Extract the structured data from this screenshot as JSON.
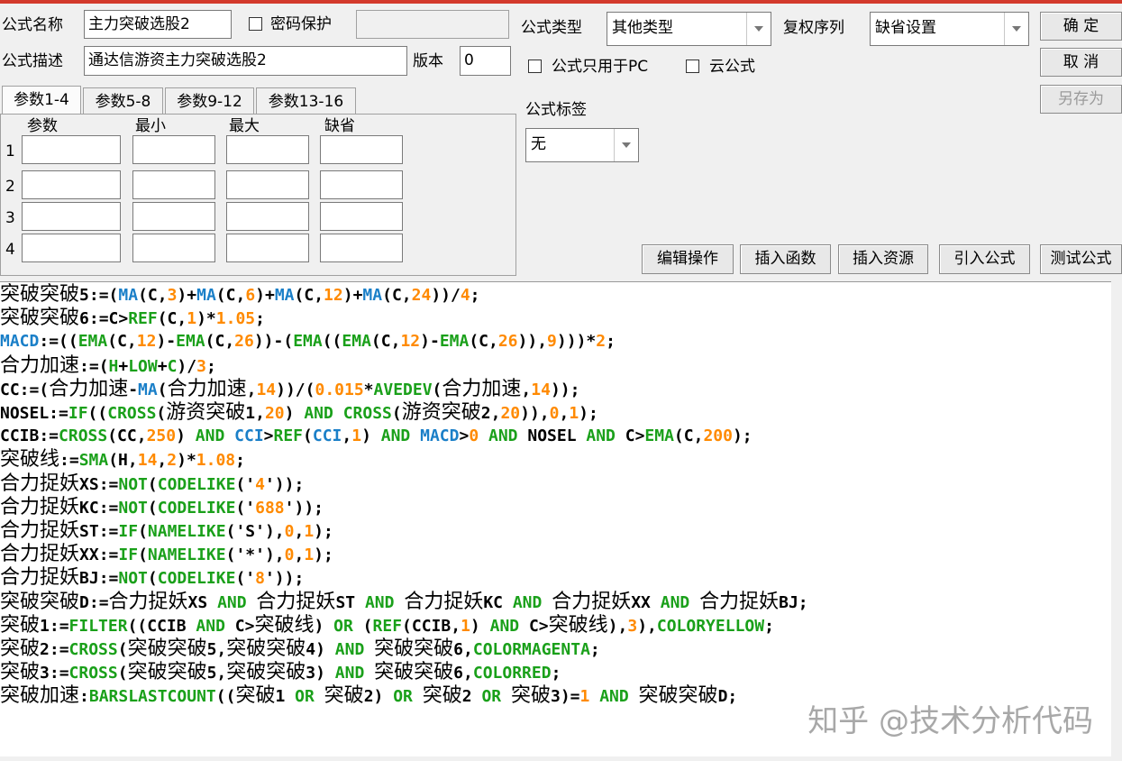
{
  "header": {
    "name_label": "公式名称",
    "name_value": "主力突破选股2",
    "password_label": "密码保护",
    "desc_label": "公式描述",
    "desc_value": "通达信游资主力突破选股2",
    "version_label": "版本",
    "version_value": "0",
    "type_label": "公式类型",
    "type_value": "其他类型",
    "rights_label": "复权序列",
    "rights_value": "缺省设置",
    "pc_only_label": "公式只用于PC",
    "cloud_label": "云公式",
    "tag_label": "公式标签",
    "tag_value": "无"
  },
  "buttons": {
    "ok": "确 定",
    "cancel": "取 消",
    "save_as": "另存为",
    "edit_ops": "编辑操作",
    "insert_func": "插入函数",
    "insert_res": "插入资源",
    "import_formula": "引入公式",
    "test_formula": "测试公式"
  },
  "tabs": [
    "参数1-4",
    "参数5-8",
    "参数9-12",
    "参数13-16"
  ],
  "param_headers": [
    "参数",
    "最小",
    "最大",
    "缺省"
  ],
  "param_rows": [
    "1",
    "2",
    "3",
    "4"
  ],
  "colors": {
    "function": "#1aa01a",
    "builtin": "#1a7fc8",
    "number": "#ff8a00",
    "text": "#000000"
  },
  "code_lines": [
    [
      [
        "zh",
        "突破突破"
      ],
      [
        "t",
        "5:=("
      ],
      [
        "b",
        "MA"
      ],
      [
        "t",
        "(C,"
      ],
      [
        "n",
        "3"
      ],
      [
        "t",
        ")+"
      ],
      [
        "b",
        "MA"
      ],
      [
        "t",
        "(C,"
      ],
      [
        "n",
        "6"
      ],
      [
        "t",
        ")+"
      ],
      [
        "b",
        "MA"
      ],
      [
        "t",
        "(C,"
      ],
      [
        "n",
        "12"
      ],
      [
        "t",
        ")+"
      ],
      [
        "b",
        "MA"
      ],
      [
        "t",
        "(C,"
      ],
      [
        "n",
        "24"
      ],
      [
        "t",
        "))/"
      ],
      [
        "n",
        "4"
      ],
      [
        "t",
        ";"
      ]
    ],
    [
      [
        "zh",
        "突破突破"
      ],
      [
        "t",
        "6:=C>"
      ],
      [
        "f",
        "REF"
      ],
      [
        "t",
        "(C,"
      ],
      [
        "n",
        "1"
      ],
      [
        "t",
        ")*"
      ],
      [
        "n",
        "1.05"
      ],
      [
        "t",
        ";"
      ]
    ],
    [
      [
        "b",
        "MACD"
      ],
      [
        "t",
        ":=(("
      ],
      [
        "f",
        "EMA"
      ],
      [
        "t",
        "(C,"
      ],
      [
        "n",
        "12"
      ],
      [
        "t",
        ")-"
      ],
      [
        "f",
        "EMA"
      ],
      [
        "t",
        "(C,"
      ],
      [
        "n",
        "26"
      ],
      [
        "t",
        "))-("
      ],
      [
        "f",
        "EMA"
      ],
      [
        "t",
        "(("
      ],
      [
        "f",
        "EMA"
      ],
      [
        "t",
        "(C,"
      ],
      [
        "n",
        "12"
      ],
      [
        "t",
        ")-"
      ],
      [
        "f",
        "EMA"
      ],
      [
        "t",
        "(C,"
      ],
      [
        "n",
        "26"
      ],
      [
        "t",
        ")),"
      ],
      [
        "n",
        "9"
      ],
      [
        "t",
        ")))*"
      ],
      [
        "n",
        "2"
      ],
      [
        "t",
        ";"
      ]
    ],
    [
      [
        "zh",
        "合力加速"
      ],
      [
        "t",
        ":=("
      ],
      [
        "f",
        "H"
      ],
      [
        "t",
        "+"
      ],
      [
        "f",
        "LOW"
      ],
      [
        "t",
        "+"
      ],
      [
        "f",
        "C"
      ],
      [
        "t",
        ")/"
      ],
      [
        "n",
        "3"
      ],
      [
        "t",
        ";"
      ]
    ],
    [
      [
        "t",
        "CC:=("
      ],
      [
        "zh",
        "合力加速"
      ],
      [
        "t",
        "-"
      ],
      [
        "b",
        "MA"
      ],
      [
        "t",
        "("
      ],
      [
        "zh",
        "合力加速"
      ],
      [
        "t",
        ","
      ],
      [
        "n",
        "14"
      ],
      [
        "t",
        "))/("
      ],
      [
        "n",
        "0.015"
      ],
      [
        "t",
        "*"
      ],
      [
        "f",
        "AVEDEV"
      ],
      [
        "t",
        "("
      ],
      [
        "zh",
        "合力加速"
      ],
      [
        "t",
        ","
      ],
      [
        "n",
        "14"
      ],
      [
        "t",
        "));"
      ]
    ],
    [
      [
        "t",
        "NOSEL:="
      ],
      [
        "f",
        "IF"
      ],
      [
        "t",
        "(("
      ],
      [
        "f",
        "CROSS"
      ],
      [
        "t",
        "("
      ],
      [
        "zh",
        "游资突破"
      ],
      [
        "t",
        "1,"
      ],
      [
        "n",
        "20"
      ],
      [
        "t",
        ") "
      ],
      [
        "f",
        "AND"
      ],
      [
        "t",
        " "
      ],
      [
        "f",
        "CROSS"
      ],
      [
        "t",
        "("
      ],
      [
        "zh",
        "游资突破"
      ],
      [
        "t",
        "2,"
      ],
      [
        "n",
        "20"
      ],
      [
        "t",
        ")),"
      ],
      [
        "n",
        "0"
      ],
      [
        "t",
        ","
      ],
      [
        "n",
        "1"
      ],
      [
        "t",
        ");"
      ]
    ],
    [
      [
        "t",
        "CCIB:="
      ],
      [
        "f",
        "CROSS"
      ],
      [
        "t",
        "(CC,"
      ],
      [
        "n",
        "250"
      ],
      [
        "t",
        ") "
      ],
      [
        "f",
        "AND"
      ],
      [
        "t",
        " "
      ],
      [
        "b",
        "CCI"
      ],
      [
        "t",
        ">"
      ],
      [
        "f",
        "REF"
      ],
      [
        "t",
        "("
      ],
      [
        "b",
        "CCI"
      ],
      [
        "t",
        ","
      ],
      [
        "n",
        "1"
      ],
      [
        "t",
        ") "
      ],
      [
        "f",
        "AND"
      ],
      [
        "t",
        " "
      ],
      [
        "b",
        "MACD"
      ],
      [
        "t",
        ">"
      ],
      [
        "n",
        "0"
      ],
      [
        "t",
        " "
      ],
      [
        "f",
        "AND"
      ],
      [
        "t",
        " NOSEL "
      ],
      [
        "f",
        "AND"
      ],
      [
        "t",
        " C>"
      ],
      [
        "f",
        "EMA"
      ],
      [
        "t",
        "(C,"
      ],
      [
        "n",
        "200"
      ],
      [
        "t",
        ");"
      ]
    ],
    [
      [
        "zh",
        "突破线"
      ],
      [
        "t",
        ":="
      ],
      [
        "f",
        "SMA"
      ],
      [
        "t",
        "(H,"
      ],
      [
        "n",
        "14"
      ],
      [
        "t",
        ","
      ],
      [
        "n",
        "2"
      ],
      [
        "t",
        ")*"
      ],
      [
        "n",
        "1.08"
      ],
      [
        "t",
        ";"
      ]
    ],
    [
      [
        "zh",
        "合力捉妖"
      ],
      [
        "t",
        "XS:="
      ],
      [
        "f",
        "NOT"
      ],
      [
        "t",
        "("
      ],
      [
        "f",
        "CODELIKE"
      ],
      [
        "t",
        "('"
      ],
      [
        "n",
        "4"
      ],
      [
        "t",
        "'));"
      ]
    ],
    [
      [
        "zh",
        "合力捉妖"
      ],
      [
        "t",
        "KC:="
      ],
      [
        "f",
        "NOT"
      ],
      [
        "t",
        "("
      ],
      [
        "f",
        "CODELIKE"
      ],
      [
        "t",
        "('"
      ],
      [
        "n",
        "688"
      ],
      [
        "t",
        "'));"
      ]
    ],
    [
      [
        "zh",
        "合力捉妖"
      ],
      [
        "t",
        "ST:="
      ],
      [
        "f",
        "IF"
      ],
      [
        "t",
        "("
      ],
      [
        "f",
        "NAMELIKE"
      ],
      [
        "t",
        "('S'),"
      ],
      [
        "n",
        "0"
      ],
      [
        "t",
        ","
      ],
      [
        "n",
        "1"
      ],
      [
        "t",
        ");"
      ]
    ],
    [
      [
        "zh",
        "合力捉妖"
      ],
      [
        "t",
        "XX:="
      ],
      [
        "f",
        "IF"
      ],
      [
        "t",
        "("
      ],
      [
        "f",
        "NAMELIKE"
      ],
      [
        "t",
        "('*'),"
      ],
      [
        "n",
        "0"
      ],
      [
        "t",
        ","
      ],
      [
        "n",
        "1"
      ],
      [
        "t",
        ");"
      ]
    ],
    [
      [
        "zh",
        "合力捉妖"
      ],
      [
        "t",
        "BJ:="
      ],
      [
        "f",
        "NOT"
      ],
      [
        "t",
        "("
      ],
      [
        "f",
        "CODELIKE"
      ],
      [
        "t",
        "('"
      ],
      [
        "n",
        "8"
      ],
      [
        "t",
        "'));"
      ]
    ],
    [
      [
        "zh",
        "突破突破"
      ],
      [
        "t",
        "D:="
      ],
      [
        "zh",
        "合力捉妖"
      ],
      [
        "t",
        "XS "
      ],
      [
        "f",
        "AND"
      ],
      [
        "t",
        " "
      ],
      [
        "zh",
        "合力捉妖"
      ],
      [
        "t",
        "ST "
      ],
      [
        "f",
        "AND"
      ],
      [
        "t",
        " "
      ],
      [
        "zh",
        "合力捉妖"
      ],
      [
        "t",
        "KC "
      ],
      [
        "f",
        "AND"
      ],
      [
        "t",
        " "
      ],
      [
        "zh",
        "合力捉妖"
      ],
      [
        "t",
        "XX "
      ],
      [
        "f",
        "AND"
      ],
      [
        "t",
        " "
      ],
      [
        "zh",
        "合力捉妖"
      ],
      [
        "t",
        "BJ;"
      ]
    ],
    [
      [
        "zh",
        "突破"
      ],
      [
        "t",
        "1:="
      ],
      [
        "f",
        "FILTER"
      ],
      [
        "t",
        "((CCIB "
      ],
      [
        "f",
        "AND"
      ],
      [
        "t",
        " C>"
      ],
      [
        "zh",
        "突破线"
      ],
      [
        "t",
        ") "
      ],
      [
        "f",
        "OR"
      ],
      [
        "t",
        " ("
      ],
      [
        "f",
        "REF"
      ],
      [
        "t",
        "(CCIB,"
      ],
      [
        "n",
        "1"
      ],
      [
        "t",
        ") "
      ],
      [
        "f",
        "AND"
      ],
      [
        "t",
        " C>"
      ],
      [
        "zh",
        "突破线"
      ],
      [
        "t",
        "),"
      ],
      [
        "n",
        "3"
      ],
      [
        "t",
        "),"
      ],
      [
        "f",
        "COLORYELLOW"
      ],
      [
        "t",
        ";"
      ]
    ],
    [
      [
        "zh",
        "突破"
      ],
      [
        "t",
        "2:="
      ],
      [
        "f",
        "CROSS"
      ],
      [
        "t",
        "("
      ],
      [
        "zh",
        "突破突破"
      ],
      [
        "t",
        "5,"
      ],
      [
        "zh",
        "突破突破"
      ],
      [
        "t",
        "4) "
      ],
      [
        "f",
        "AND"
      ],
      [
        "t",
        " "
      ],
      [
        "zh",
        "突破突破"
      ],
      [
        "t",
        "6,"
      ],
      [
        "f",
        "COLORMAGENTA"
      ],
      [
        "t",
        ";"
      ]
    ],
    [
      [
        "zh",
        "突破"
      ],
      [
        "t",
        "3:="
      ],
      [
        "f",
        "CROSS"
      ],
      [
        "t",
        "("
      ],
      [
        "zh",
        "突破突破"
      ],
      [
        "t",
        "5,"
      ],
      [
        "zh",
        "突破突破"
      ],
      [
        "t",
        "3) "
      ],
      [
        "f",
        "AND"
      ],
      [
        "t",
        " "
      ],
      [
        "zh",
        "突破突破"
      ],
      [
        "t",
        "6,"
      ],
      [
        "f",
        "COLORRED"
      ],
      [
        "t",
        ";"
      ]
    ],
    [
      [
        "zh",
        "突破加速"
      ],
      [
        "t",
        ":"
      ],
      [
        "f",
        "BARSLASTCOUNT"
      ],
      [
        "t",
        "(("
      ],
      [
        "zh",
        "突破"
      ],
      [
        "t",
        "1 "
      ],
      [
        "f",
        "OR"
      ],
      [
        "t",
        " "
      ],
      [
        "zh",
        "突破"
      ],
      [
        "t",
        "2) "
      ],
      [
        "f",
        "OR"
      ],
      [
        "t",
        " "
      ],
      [
        "zh",
        "突破"
      ],
      [
        "t",
        "2 "
      ],
      [
        "f",
        "OR"
      ],
      [
        "t",
        " "
      ],
      [
        "zh",
        "突破"
      ],
      [
        "t",
        "3)="
      ],
      [
        "n",
        "1"
      ],
      [
        "t",
        " "
      ],
      [
        "f",
        "AND"
      ],
      [
        "t",
        " "
      ],
      [
        "zh",
        "突破突破"
      ],
      [
        "t",
        "D;"
      ]
    ]
  ],
  "watermark": "知乎 @技术分析代码"
}
